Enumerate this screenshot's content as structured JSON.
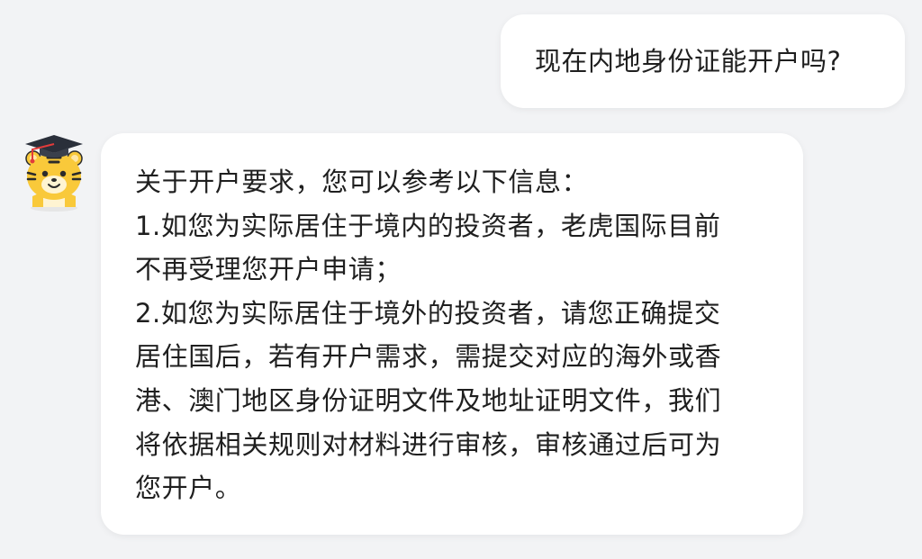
{
  "conversation": {
    "user_message": "现在内地身份证能开户吗?",
    "assistant": {
      "avatar_icon": "tiger-graduate-icon",
      "lines": [
        "关于开户要求，您可以参考以下信息：",
        "1.如您为实际居住于境内的投资者，老虎国际目前",
        "不再受理您开户申请；",
        "2.如您为实际居住于境外的投资者，请您正确提交",
        "居住国后，若有开户需求，需提交对应的海外或香",
        "港、澳门地区身份证明文件及地址证明文件，我们",
        "将依据相关规则对材料进行审核，审核通过后可为",
        "您开户。"
      ]
    }
  },
  "colors": {
    "background": "#f2f3f5",
    "bubble": "#ffffff",
    "text": "#1f1f1f",
    "tiger_body": "#f9c93a",
    "tiger_stripes": "#2b2b2b",
    "cap": "#2a2f3a",
    "tassel": "#e23b3b"
  }
}
